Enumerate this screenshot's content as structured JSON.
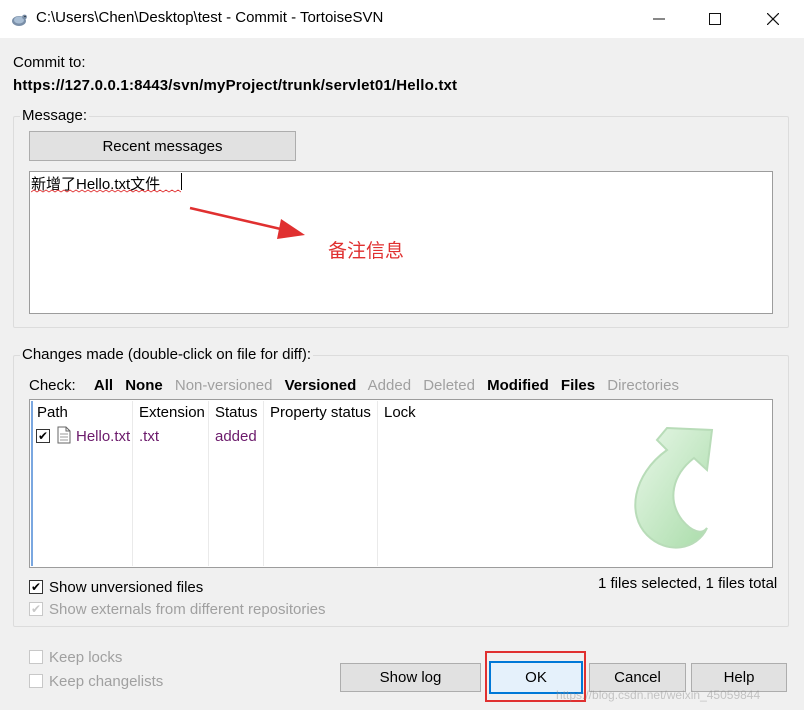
{
  "window": {
    "title": "C:\\Users\\Chen\\Desktop\\test - Commit - TortoiseSVN",
    "minimize": "—",
    "maximize": "☐",
    "close": "✕"
  },
  "commit": {
    "label": "Commit to:",
    "url": "https://127.0.0.1:8443/svn/myProject/trunk/servlet01/Hello.txt"
  },
  "message": {
    "group_label": "Message:",
    "recent_button": "Recent messages",
    "text": "新增了Hello.txt文件",
    "annotation": "备注信息"
  },
  "changes": {
    "group_label": "Changes made (double-click on file for diff):",
    "check_label": "Check:",
    "filters": [
      {
        "label": "All",
        "enabled": true
      },
      {
        "label": "None",
        "enabled": true
      },
      {
        "label": "Non-versioned",
        "enabled": false
      },
      {
        "label": "Versioned",
        "enabled": true
      },
      {
        "label": "Added",
        "enabled": false
      },
      {
        "label": "Deleted",
        "enabled": false
      },
      {
        "label": "Modified",
        "enabled": true
      },
      {
        "label": "Files",
        "enabled": true
      },
      {
        "label": "Directories",
        "enabled": false
      }
    ],
    "columns": {
      "path": "Path",
      "extension": "Extension",
      "status": "Status",
      "property_status": "Property status",
      "lock": "Lock"
    },
    "rows": [
      {
        "checked": true,
        "path": "Hello.txt",
        "extension": ".txt",
        "status": "added"
      }
    ],
    "show_unversioned": {
      "label": "Show unversioned files",
      "checked": true
    },
    "show_externals": {
      "label": "Show externals from different repositories",
      "checked": true,
      "disabled": true
    },
    "summary": "1 files selected, 1 files total"
  },
  "options": {
    "keep_locks": "Keep locks",
    "keep_changelists": "Keep changelists"
  },
  "buttons": {
    "show_log": "Show log",
    "ok": "OK",
    "cancel": "Cancel",
    "help": "Help"
  },
  "watermark": "https://blog.csdn.net/weixin_45059844",
  "colors": {
    "annotation": "#e03030",
    "added_file": "#6b1a6b",
    "ok_border": "#0078d7"
  },
  "icons": {
    "app": "tortoise-icon",
    "file": "file-icon",
    "commit_arrow": "green-commit-arrow-icon"
  }
}
